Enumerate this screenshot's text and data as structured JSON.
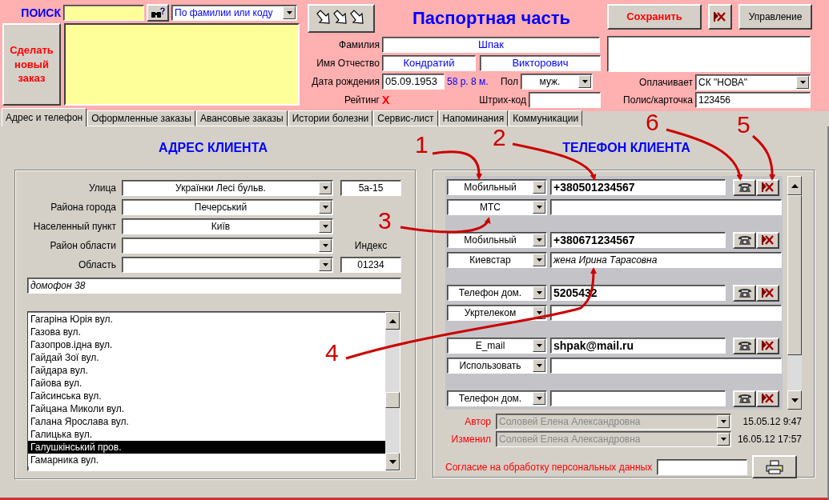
{
  "search": {
    "label": "ПОИСК",
    "mode": "По фамилии или коду"
  },
  "new_order_button": "Сделать новый заказ",
  "title": "Паспортная часть",
  "header_buttons": {
    "save": "Сохранить",
    "manage": "Управление"
  },
  "passport": {
    "surname_label": "Фамилия",
    "surname": "Шпак",
    "name_label": "Имя Отчество",
    "first_name": "Кондратий",
    "patronymic": "Викторович",
    "birth_label": "Дата рождения",
    "birth_date": "05.09.1953",
    "age": "58 р. 8 м.",
    "sex_label": "Пол",
    "sex": "муж.",
    "rating_label": "Рейтинг",
    "rating": "X",
    "barcode_label": "Штрих-код",
    "payer_label": "Оплачивает",
    "payer": "СК \"НОВА\"",
    "policy_label": "Полис/карточка",
    "policy": "123456"
  },
  "tabs": [
    {
      "label": "Адрес и телефон",
      "selected": true
    },
    {
      "label": "Оформленные заказы",
      "selected": false
    },
    {
      "label": "Авансовые заказы",
      "selected": false
    },
    {
      "label": "Истории болезни",
      "selected": false
    },
    {
      "label": "Сервис-лист",
      "selected": false
    },
    {
      "label": "Напоминания",
      "selected": false
    },
    {
      "label": "Коммуникации",
      "selected": false
    }
  ],
  "address": {
    "title": "АДРЕС КЛИЕНТА",
    "fields": [
      {
        "label": "Улица",
        "value": "Українки Лесі бульв.",
        "extra": "5а-15"
      },
      {
        "label": "Района города",
        "value": "Печерський"
      },
      {
        "label": "Населенный пункт",
        "value": "Київ"
      },
      {
        "label": "Район области",
        "extra_label": "Индекс"
      },
      {
        "label": "Область",
        "extra": "01234"
      }
    ],
    "note": "домофон 38",
    "streets": [
      {
        "name": "Гагаріна Юрія вул.",
        "selected": false
      },
      {
        "name": "Газова вул.",
        "selected": false
      },
      {
        "name": "Газопров.ідна вул.",
        "selected": false
      },
      {
        "name": "Гайдай Зої вул.",
        "selected": false
      },
      {
        "name": "Гайдара вул.",
        "selected": false
      },
      {
        "name": "Гайова вул.",
        "selected": false
      },
      {
        "name": "Гайсинська вул.",
        "selected": false
      },
      {
        "name": "Гайцана Миколи вул.",
        "selected": false
      },
      {
        "name": "Галана Ярослава вул.",
        "selected": false
      },
      {
        "name": "Галицька вул.",
        "selected": false
      },
      {
        "name": "Галушкінський пров.",
        "selected": true
      },
      {
        "name": "Гамарника вул.",
        "selected": false
      }
    ]
  },
  "phones": {
    "title": "ТЕЛЕФОН КЛИЕНТА",
    "entries": [
      {
        "type": "Мобильный",
        "value": "+380501234567",
        "operator": "МТС"
      },
      {
        "type": "Мобильный",
        "value": "+380671234567",
        "operator": "Киевстар",
        "note": "жена Ирина Тарасовна"
      },
      {
        "type": "Телефон дом.",
        "value": "5205432",
        "operator": "Укртелеком"
      },
      {
        "type": "E_mail",
        "value": "shpak@mail.ru",
        "operator": "Использовать"
      },
      {
        "type": "Телефон дом."
      }
    ]
  },
  "audit": [
    {
      "label": "Автор",
      "value": "Соловей Елена Александровна",
      "time": "15.05.12 9:47",
      "disabled": true
    },
    {
      "label": "Изменил",
      "value": "Соловей Елена Александровна",
      "time": "16.05.12 17:57",
      "disabled": true
    }
  ],
  "consent": {
    "label": "Согласие на обработку персональных данных"
  },
  "annotations": [
    {
      "label": "1"
    },
    {
      "label": "2"
    },
    {
      "label": "3"
    },
    {
      "label": "4"
    },
    {
      "label": "5"
    },
    {
      "label": "6"
    }
  ]
}
